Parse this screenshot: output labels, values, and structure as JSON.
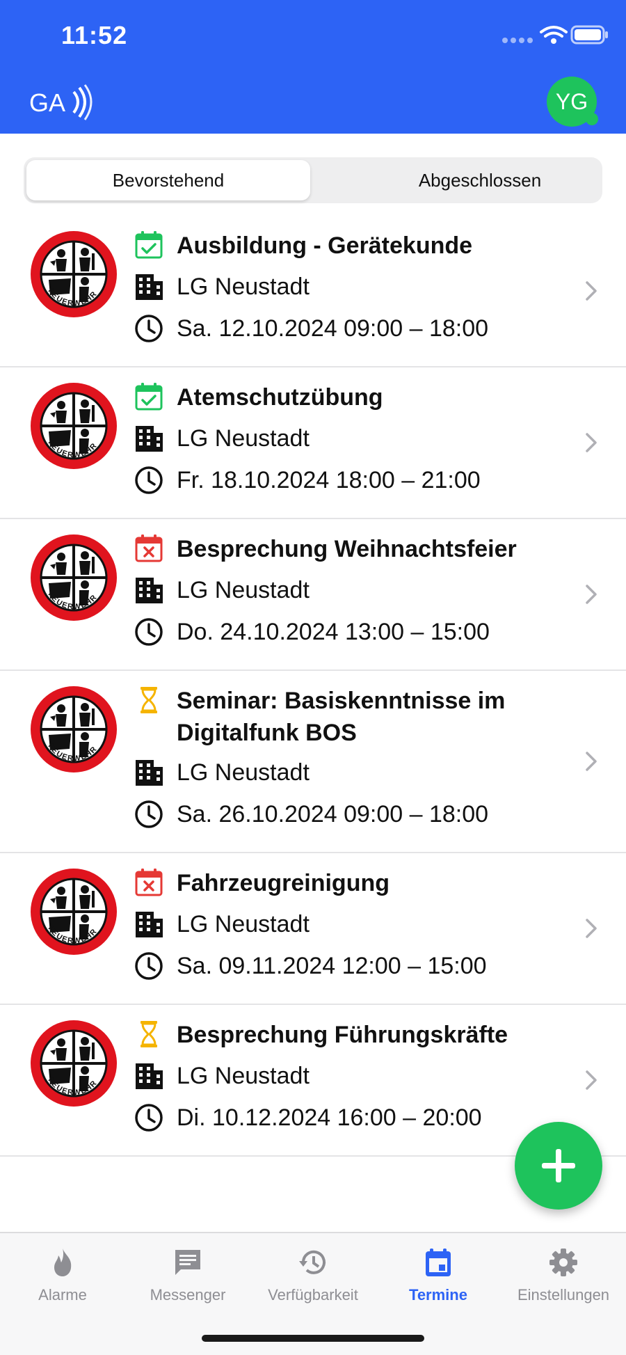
{
  "status": {
    "time": "11:52"
  },
  "header": {
    "logo_text": "GA",
    "avatar_initials": "YG"
  },
  "segments": {
    "upcoming": "Bevorstehend",
    "completed": "Abgeschlossen",
    "selected": "upcoming"
  },
  "events": [
    {
      "title": "Ausbildung - Gerätekunde",
      "location": "LG Neustadt",
      "time": "Sa. 12.10.2024 09:00 – 18:00",
      "status_icon": "calendar-check-icon"
    },
    {
      "title": "Atemschutzübung",
      "location": "LG Neustadt",
      "time": "Fr. 18.10.2024 18:00 – 21:00",
      "status_icon": "calendar-check-icon"
    },
    {
      "title": "Besprechung Weihnachtsfeier",
      "location": "LG Neustadt",
      "time": "Do. 24.10.2024 13:00 – 15:00",
      "status_icon": "calendar-x-icon"
    },
    {
      "title": "Seminar: Basiskenntnisse im Digitalfunk BOS",
      "location": "LG Neustadt",
      "time": "Sa. 26.10.2024 09:00 – 18:00",
      "status_icon": "hourglass-icon"
    },
    {
      "title": "Fahrzeugreinigung",
      "location": "LG Neustadt",
      "time": "Sa. 09.11.2024 12:00 – 15:00",
      "status_icon": "calendar-x-icon"
    },
    {
      "title": "Besprechung Führungskräfte",
      "location": "LG Neustadt",
      "time": "Di. 10.12.2024 16:00 – 20:00",
      "status_icon": "hourglass-icon"
    }
  ],
  "emblem_text": "FEUERWEHR",
  "tabs": [
    {
      "label": "Alarme",
      "icon": "flame-icon"
    },
    {
      "label": "Messenger",
      "icon": "chat-icon"
    },
    {
      "label": "Verfügbarkeit",
      "icon": "history-icon"
    },
    {
      "label": "Termine",
      "icon": "calendar-icon",
      "active": true
    },
    {
      "label": "Einstellungen",
      "icon": "gear-icon"
    }
  ],
  "colors": {
    "accent": "#2d63f5",
    "green": "#1ec35c",
    "red": "#e53935",
    "amber": "#f5b400"
  }
}
